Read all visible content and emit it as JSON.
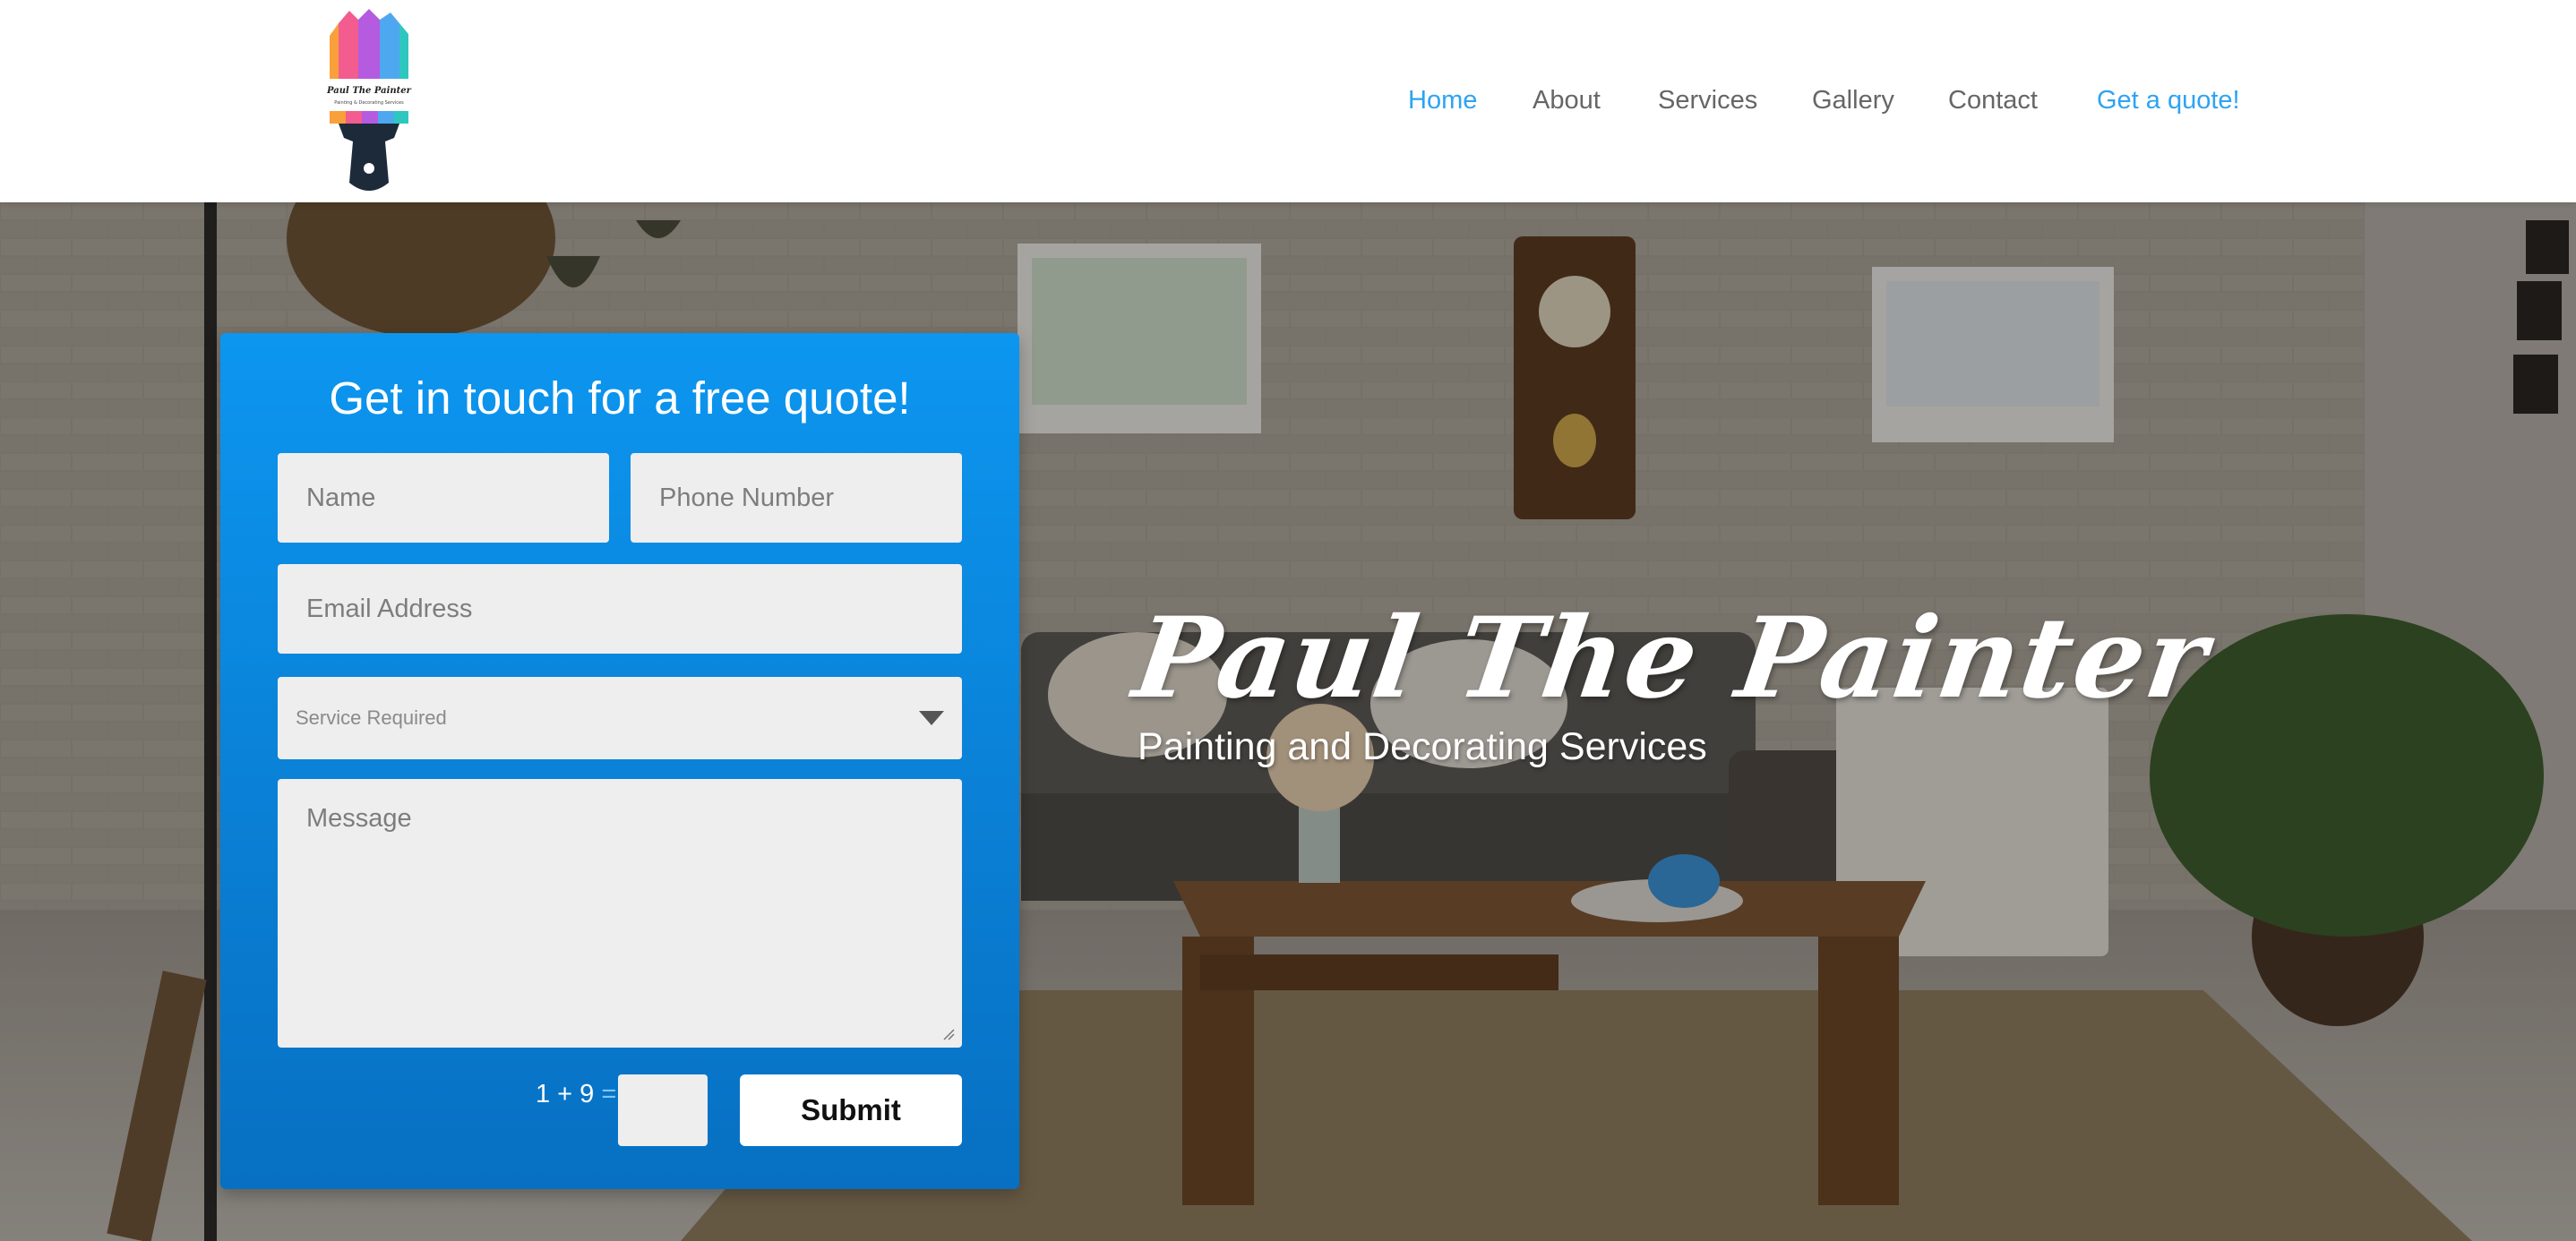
{
  "brand": {
    "logo_name": "Paul The Painter",
    "logo_tagline": "Painting & Decorating Services",
    "logo_icon": "paintbrush-icon"
  },
  "nav": {
    "items": [
      {
        "label": "Home",
        "active": true
      },
      {
        "label": "About",
        "active": false
      },
      {
        "label": "Services",
        "active": false
      },
      {
        "label": "Gallery",
        "active": false
      },
      {
        "label": "Contact",
        "active": false
      },
      {
        "label": "Get a quote!",
        "active": false
      }
    ]
  },
  "hero": {
    "title": "Paul The Painter",
    "subtitle": "Painting and Decorating Services"
  },
  "form": {
    "title": "Get in touch for a free quote!",
    "name_placeholder": "Name",
    "phone_placeholder": "Phone Number",
    "email_placeholder": "Email Address",
    "service_placeholder": "Service Required",
    "message_placeholder": "Message",
    "captcha_question": "1 + 9",
    "captcha_equals": "=",
    "captcha_value": "",
    "submit_label": "Submit"
  },
  "colors": {
    "accent": "#2ea3f2",
    "nav_text": "#666666",
    "form_top": "#0c96f0",
    "form_bottom": "#0770c2",
    "field_bg": "#eeeeee"
  }
}
